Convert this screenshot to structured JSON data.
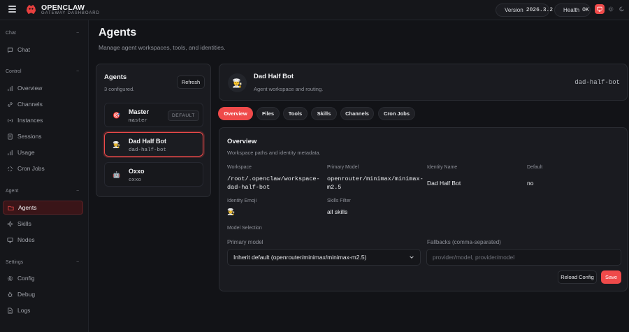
{
  "brand": {
    "title": "OPENCLAW",
    "subtitle": "GATEWAY DASHBOARD"
  },
  "status": {
    "version_label": "Version",
    "version_value": "2026.3.2",
    "health_label": "Health",
    "health_value": "OK"
  },
  "sidebar": {
    "sections": [
      {
        "title": "Chat",
        "items": [
          {
            "label": "Chat",
            "icon": "chat-icon"
          }
        ]
      },
      {
        "title": "Control",
        "items": [
          {
            "label": "Overview",
            "icon": "bar-chart-icon"
          },
          {
            "label": "Channels",
            "icon": "link-icon"
          },
          {
            "label": "Instances",
            "icon": "broadcast-icon"
          },
          {
            "label": "Sessions",
            "icon": "document-icon"
          },
          {
            "label": "Usage",
            "icon": "bar-chart-icon"
          },
          {
            "label": "Cron Jobs",
            "icon": "loader-icon"
          }
        ]
      },
      {
        "title": "Agent",
        "items": [
          {
            "label": "Agents",
            "icon": "folder-icon",
            "active": true
          },
          {
            "label": "Skills",
            "icon": "sparkle-icon"
          },
          {
            "label": "Nodes",
            "icon": "monitor-icon"
          }
        ]
      },
      {
        "title": "Settings",
        "items": [
          {
            "label": "Config",
            "icon": "gear-icon"
          },
          {
            "label": "Debug",
            "icon": "bug-icon"
          },
          {
            "label": "Logs",
            "icon": "file-text-icon"
          }
        ]
      }
    ]
  },
  "page": {
    "title": "Agents",
    "subtitle": "Manage agent workspaces, tools, and identities."
  },
  "agents_panel": {
    "title": "Agents",
    "count_text": "3 configured.",
    "refresh_label": "Refresh",
    "items": [
      {
        "name": "Master",
        "id": "master",
        "emoji": "🎯",
        "badge": "DEFAULT",
        "selected": false
      },
      {
        "name": "Dad Half Bot",
        "id": "dad-half-bot",
        "emoji": "👨‍🍳",
        "selected": true
      },
      {
        "name": "Oxxo",
        "id": "oxxo",
        "emoji": "🤖",
        "selected": false
      }
    ]
  },
  "agent_header": {
    "name": "Dad Half Bot",
    "subtitle": "Agent workspace and routing.",
    "id": "dad-half-bot",
    "emoji": "👨‍🍳"
  },
  "tabs": [
    {
      "label": "Overview",
      "active": true
    },
    {
      "label": "Files"
    },
    {
      "label": "Tools"
    },
    {
      "label": "Skills"
    },
    {
      "label": "Channels"
    },
    {
      "label": "Cron Jobs"
    }
  ],
  "overview": {
    "title": "Overview",
    "subtitle": "Workspace paths and identity metadata.",
    "workspace_label": "Workspace",
    "workspace_value_line1": "/root/.openclaw/workspace-",
    "workspace_value_line2": "dad-half-bot",
    "primary_model_label": "Primary Model",
    "primary_model_line1": "openrouter/minimax/minimax-",
    "primary_model_line2": "m2.5",
    "identity_name_label": "Identity Name",
    "identity_name_value": "Dad Half Bot",
    "default_label": "Default",
    "default_value": "no",
    "identity_emoji_label": "Identity Emoji",
    "identity_emoji_value": "👨‍🍳",
    "skills_filter_label": "Skills Filter",
    "skills_filter_value": "all skills",
    "model_selection_label": "Model Selection",
    "primary_model_field_label": "Primary model",
    "primary_model_select_value": "Inherit default (openrouter/minimax/minimax-m2.5)",
    "fallbacks_label": "Fallbacks (comma-separated)",
    "fallbacks_placeholder": "provider/model, provider/model",
    "reload_label": "Reload Config",
    "save_label": "Save"
  },
  "colors": {
    "accent": "#ef4a4a",
    "background": "#121317",
    "card": "#1a1b20",
    "health_ok": "#3ccf6b"
  }
}
